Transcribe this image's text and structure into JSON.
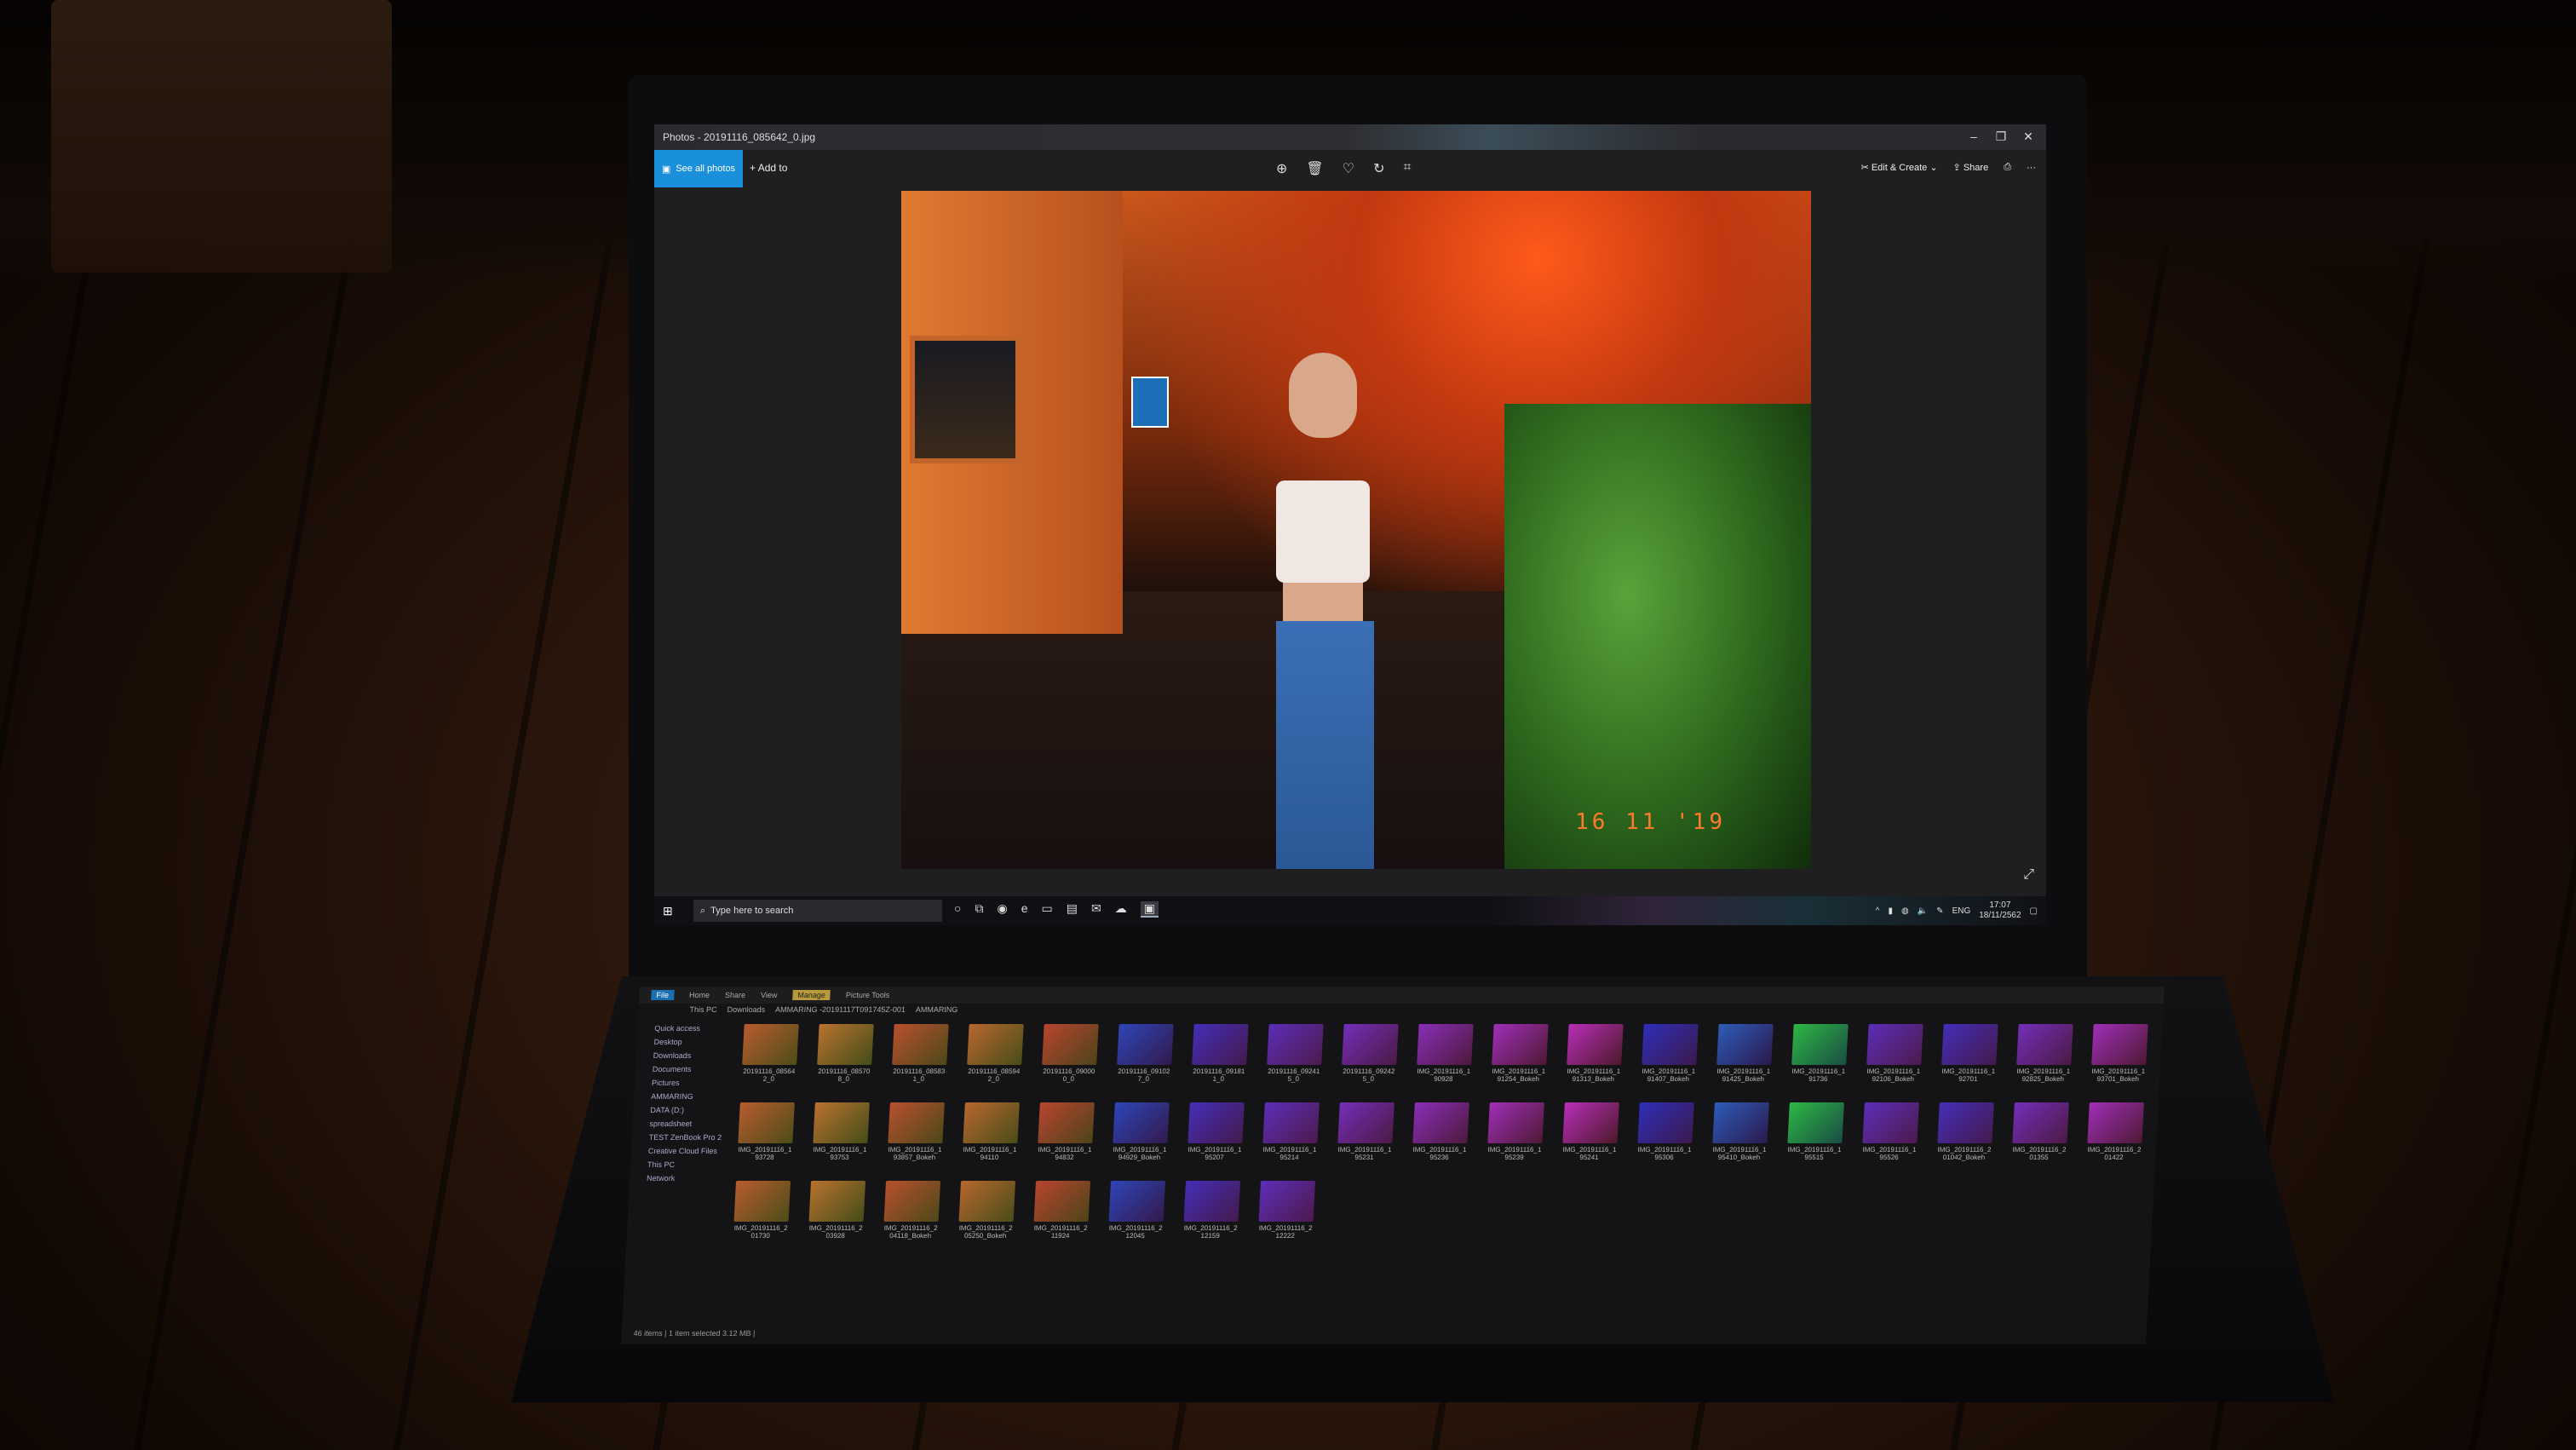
{
  "window": {
    "title": "Photos - 20191116_085642_0.jpg",
    "minimize": "–",
    "restore": "❐",
    "close": "✕"
  },
  "toolbar": {
    "see_all_photos": "See all photos",
    "add_to": "Add to",
    "zoom_icon": "zoom-icon",
    "delete_icon": "delete-icon",
    "favorite_icon": "heart-icon",
    "rotate_icon": "rotate-icon",
    "crop_icon": "crop-icon",
    "edit_create": "Edit & Create",
    "share": "Share",
    "more": "···"
  },
  "photo": {
    "date_stamp": "16 11 '19"
  },
  "taskbar": {
    "search_placeholder": "Type here to search",
    "language": "ENG",
    "time": "17:07",
    "date": "18/11/2562"
  },
  "explorer": {
    "tabs": [
      "File",
      "Home",
      "Share",
      "View",
      "Manage",
      "Picture Tools"
    ],
    "path": [
      "This PC",
      "Downloads",
      "AMMARING -20191117T091745Z-001",
      "AMMARING"
    ],
    "nav": [
      "Quick access",
      "Desktop",
      "Downloads",
      "Documents",
      "Pictures",
      "AMMARING",
      "DATA (D:)",
      "spreadsheet",
      "TEST ZenBook Pro 2",
      "Creative Cloud Files",
      "This PC",
      "Network"
    ],
    "thumbs": [
      "20191116_08564 2_0",
      "20191116_08570 8_0",
      "20191116_08583 1_0",
      "20191116_08594 2_0",
      "20191116_09000 0_0",
      "20191116_09102 7_0",
      "20191116_09181 1_0",
      "20191116_09241 5_0",
      "20191116_09242 5_0",
      "IMG_20191116_1 90928",
      "IMG_20191116_1 91254_Bokeh",
      "IMG_20191116_1 91313_Bokeh",
      "IMG_20191116_1 91407_Bokeh",
      "IMG_20191116_1 91425_Bokeh",
      "IMG_20191116_1 91736",
      "IMG_20191116_1 92106_Bokeh",
      "IMG_20191116_1 92701",
      "IMG_20191116_1 92825_Bokeh",
      "IMG_20191116_1 93701_Bokeh",
      "IMG_20191116_1 93728",
      "IMG_20191116_1 93753",
      "IMG_20191116_1 93857_Bokeh",
      "IMG_20191116_1 94110",
      "IMG_20191116_1 94832",
      "IMG_20191116_1 94929_Bokeh",
      "IMG_20191116_1 95207",
      "IMG_20191116_1 95214",
      "IMG_20191116_1 95231",
      "IMG_20191116_1 95236",
      "IMG_20191116_1 95239",
      "IMG_20191116_1 95241",
      "IMG_20191116_1 95306",
      "IMG_20191116_1 95410_Bokeh",
      "IMG_20191116_1 95515",
      "IMG_20191116_1 95526",
      "IMG_20191116_2 01042_Bokeh",
      "IMG_20191116_2 01355",
      "IMG_20191116_2 01422",
      "IMG_20191116_2 01730",
      "IMG_20191116_2 03928",
      "IMG_20191116_2 04118_Bokeh",
      "IMG_20191116_2 05250_Bokeh",
      "IMG_20191116_2 11924",
      "IMG_20191116_2 12045",
      "IMG_20191116_2 12159",
      "IMG_20191116_2 12222"
    ],
    "status": "46 items | 1 item selected 3.12 MB |"
  }
}
